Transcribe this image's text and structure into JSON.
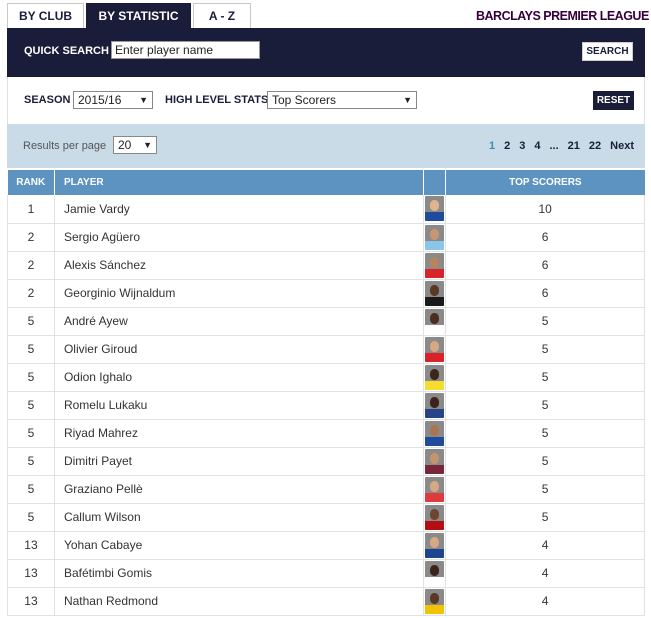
{
  "tabs": [
    "BY CLUB",
    "BY STATISTIC",
    "A - Z"
  ],
  "logo": "BARCLAYS PREMIER LEAGUE",
  "quick_search": {
    "label": "QUICK SEARCH",
    "placeholder": "Enter player name",
    "button": "SEARCH"
  },
  "filters": {
    "season_label": "SEASON",
    "season_value": "2015/16",
    "stats_label": "HIGH LEVEL STATS",
    "stats_value": "Top Scorers",
    "reset": "RESET"
  },
  "results": {
    "per_page_label": "Results per page",
    "per_page_value": "20",
    "pages": [
      "1",
      "2",
      "3",
      "4",
      "...",
      "21",
      "22",
      "Next"
    ]
  },
  "table": {
    "headers": {
      "rank": "RANK",
      "player": "PLAYER",
      "score": "TOP SCORERS"
    },
    "rows": [
      {
        "rank": "1",
        "player": "Jamie Vardy",
        "score": "10",
        "shirt": "#1e4b9c",
        "skin": "#e2b48e"
      },
      {
        "rank": "2",
        "player": "Sergio Agüero",
        "score": "6",
        "shirt": "#8ac6ea",
        "skin": "#c89672"
      },
      {
        "rank": "2",
        "player": "Alexis Sánchez",
        "score": "6",
        "shirt": "#d9222a",
        "skin": "#b7845e"
      },
      {
        "rank": "2",
        "player": "Georginio Wijnaldum",
        "score": "6",
        "shirt": "#1a1a1a",
        "skin": "#5a3826"
      },
      {
        "rank": "5",
        "player": "André Ayew",
        "score": "5",
        "shirt": "#ffffff",
        "skin": "#4a2e1e"
      },
      {
        "rank": "5",
        "player": "Olivier Giroud",
        "score": "5",
        "shirt": "#d9222a",
        "skin": "#d6a883"
      },
      {
        "rank": "5",
        "player": "Odion Ighalo",
        "score": "5",
        "shirt": "#f6dc2b",
        "skin": "#3c261a"
      },
      {
        "rank": "5",
        "player": "Romelu Lukaku",
        "score": "5",
        "shirt": "#274488",
        "skin": "#3b2419"
      },
      {
        "rank": "5",
        "player": "Riyad Mahrez",
        "score": "5",
        "shirt": "#1e4b9c",
        "skin": "#a9764f"
      },
      {
        "rank": "5",
        "player": "Dimitri Payet",
        "score": "5",
        "shirt": "#7a263a",
        "skin": "#c49471"
      },
      {
        "rank": "5",
        "player": "Graziano Pellè",
        "score": "5",
        "shirt": "#e03a3e",
        "skin": "#d6a883"
      },
      {
        "rank": "5",
        "player": "Callum Wilson",
        "score": "5",
        "shirt": "#b50e12",
        "skin": "#6b4630"
      },
      {
        "rank": "13",
        "player": "Yohan Cabaye",
        "score": "4",
        "shirt": "#1b458f",
        "skin": "#d7a883"
      },
      {
        "rank": "13",
        "player": "Bafétimbi Gomis",
        "score": "4",
        "shirt": "#ffffff",
        "skin": "#3b2419"
      },
      {
        "rank": "13",
        "player": "Nathan Redmond",
        "score": "4",
        "shirt": "#f2c300",
        "skin": "#5a3826"
      }
    ]
  }
}
